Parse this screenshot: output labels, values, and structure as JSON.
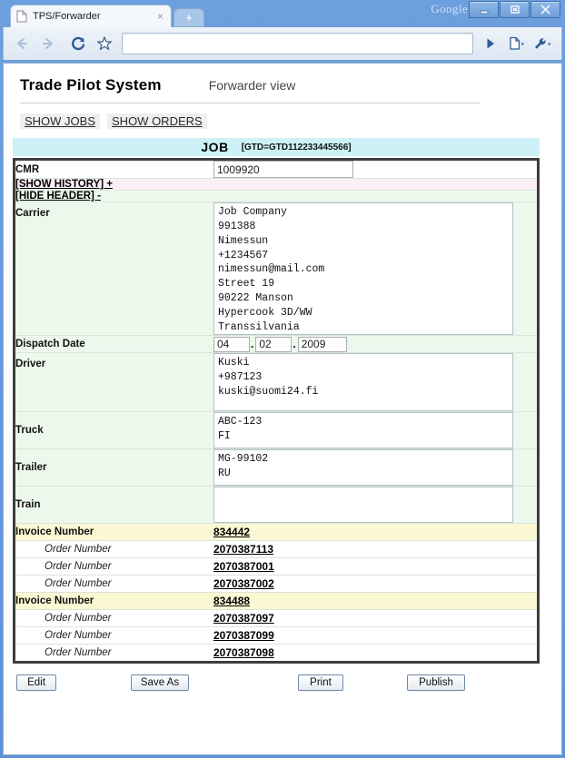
{
  "window": {
    "brand_label": "Google",
    "minimize_label": "minimize",
    "maximize_label": "maximize",
    "close_label": "close"
  },
  "tabs": [
    {
      "title": "TPS/Forwarder",
      "close_label": "×"
    }
  ],
  "new_tab_label": "+",
  "toolbar": {
    "back_label": "Back",
    "forward_label": "Forward",
    "reload_label": "Reload",
    "bookmark_label": "Bookmark",
    "go_label": "Go",
    "page_menu_label": "Page menu",
    "tools_menu_label": "Tools menu",
    "address_value": "",
    "address_placeholder": ""
  },
  "page": {
    "app_name": "Trade Pilot System",
    "view_name": "Forwarder view",
    "nav": [
      {
        "label": "SHOW JOBS"
      },
      {
        "label": "SHOW ORDERS"
      }
    ],
    "job_header": {
      "title": "JOB",
      "gtd": "[GTD=GTD112233445566]"
    },
    "fields": {
      "cmr_label": "CMR",
      "cmr_value": "1009920",
      "show_history_label": "[SHOW HISTORY] +",
      "hide_header_label": "[HIDE HEADER] -",
      "carrier_label": "Carrier",
      "carrier_value": "Job Company\n991388\nNimessun\n+1234567\nnimessun@mail.com\nStreet 19\n90222 Manson\nHypercook 3D/WW\nTranssilvania",
      "dispatch_date_label": "Dispatch Date",
      "dispatch_day": "04",
      "dispatch_month": "02",
      "dispatch_year": "2009",
      "date_sep": ".",
      "driver_label": "Driver",
      "driver_value": "Kuski\n+987123\nkuski@suomi24.fi",
      "truck_label": "Truck",
      "truck_value": "ABC-123\nFI",
      "trailer_label": "Trailer",
      "trailer_value": "MG-99102\nRU",
      "train_label": "Train",
      "train_value": ""
    },
    "invoices": [
      {
        "label": "Invoice Number",
        "number": "834442",
        "orders": [
          {
            "label": "Order Number",
            "number": "2070387113"
          },
          {
            "label": "Order Number",
            "number": "2070387001"
          },
          {
            "label": "Order Number",
            "number": "2070387002"
          }
        ]
      },
      {
        "label": "Invoice Number",
        "number": "834488",
        "orders": [
          {
            "label": "Order Number",
            "number": "2070387097"
          },
          {
            "label": "Order Number",
            "number": "2070387099"
          },
          {
            "label": "Order Number",
            "number": "2070387098"
          }
        ]
      }
    ],
    "actions": [
      {
        "label": "Edit"
      },
      {
        "label": "Save As"
      },
      {
        "label": "Print"
      },
      {
        "label": "Publish"
      }
    ]
  },
  "colors": {
    "job_header_bg": "#ccf2f7",
    "row_green_bg": "#edf8ed",
    "row_pink_bg": "#fceef6",
    "row_yellow_bg": "#fbf8d4",
    "chrome_blue": "#5f92d4"
  }
}
